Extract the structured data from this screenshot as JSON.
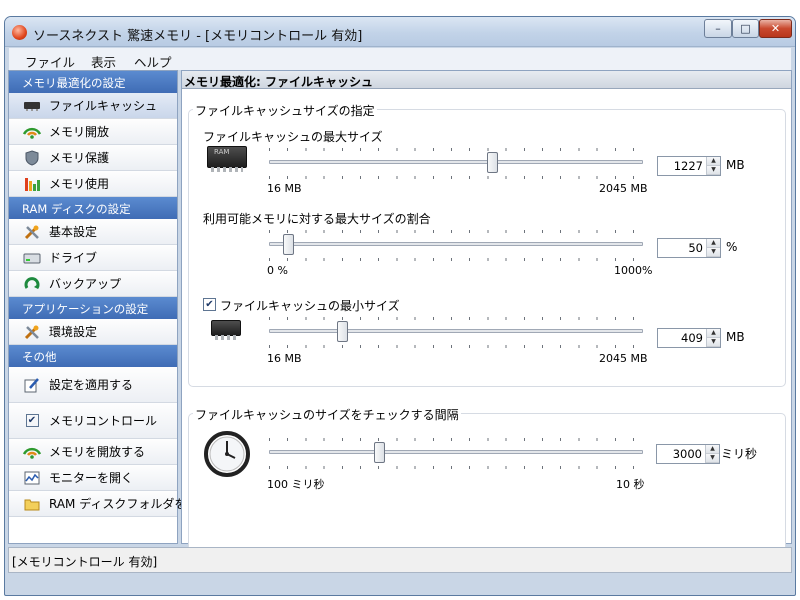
{
  "window": {
    "title": "ソースネクスト 驚速メモリ - [メモリコントロール 有効]",
    "buttons": {
      "minimize": "–",
      "maximize": "□",
      "close": "✕"
    }
  },
  "menubar": {
    "file": "ファイル",
    "view": "表示",
    "help": "ヘルプ"
  },
  "sidebar": {
    "cat_memory": "メモリ最適化の設定",
    "file_cache": "ファイルキャッシュ",
    "memory_release": "メモリ開放",
    "memory_protect": "メモリ保護",
    "memory_usage": "メモリ使用",
    "cat_ramdisk": "RAM ディスクの設定",
    "basic_settings": "基本設定",
    "drive": "ドライブ",
    "backup": "バックアップ",
    "cat_app": "アプリケーションの設定",
    "env_settings": "環境設定",
    "cat_other": "その他",
    "apply_settings": "設定を適用する",
    "memory_control": "メモリコントロール",
    "memory_control_checked": true,
    "release_memory": "メモリを開放する",
    "open_monitor": "モニターを開く",
    "open_ramdisk_folder": "RAM ディスクフォルダを開く"
  },
  "main": {
    "header": "メモリ最適化: ファイルキャッシュ",
    "size_group": {
      "title": "ファイルキャッシュサイズの指定",
      "max_size": {
        "label": "ファイルキャッシュの最大サイズ",
        "min_label": "16 MB",
        "max_label": "2045 MB",
        "value": "1227",
        "unit": "MB",
        "position": 0.597
      },
      "max_ratio": {
        "label": "利用可能メモリに対する最大サイズの割合",
        "min_label": "0 %",
        "max_label": "1000%",
        "value": "50",
        "unit": "%",
        "position": 0.05
      },
      "min_size": {
        "label": "ファイルキャッシュの最小サイズ",
        "checked": true,
        "min_label": "16 MB",
        "max_label": "2045 MB",
        "value": "409",
        "unit": "MB",
        "position": 0.194
      }
    },
    "interval_group": {
      "title": "ファイルキャッシュのサイズをチェックする間隔",
      "interval": {
        "min_label": "100 ミリ秒",
        "max_label": "10 秒",
        "value": "3000",
        "unit": "ミリ秒",
        "position": 0.293
      }
    }
  },
  "statusbar": {
    "text": "[メモリコントロール 有効]"
  },
  "icon_text": {
    "ram_chip": "RAM"
  },
  "colors": {
    "accent": "#3f6cb5",
    "title_bar": "#c2d3e8",
    "close_button": "#c9492e"
  }
}
